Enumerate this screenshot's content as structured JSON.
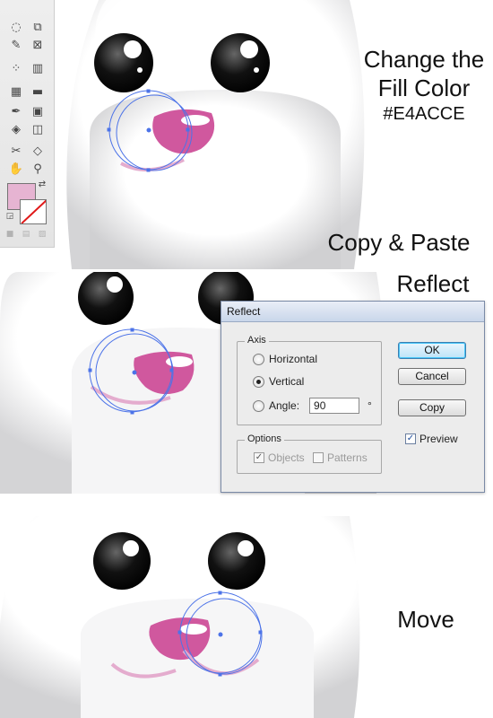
{
  "captions": {
    "step1_line1": "Change the",
    "step1_line2": "Fill Color",
    "step1_hex": "#E4ACCE",
    "step2": "Copy & Paste",
    "step3": "Reflect",
    "step4": "Move"
  },
  "colors": {
    "nose": "#D0589E",
    "fill_swatch": "#E4ACCE",
    "selection": "#4C73E8",
    "mouth_stroke": "#E4ACCE"
  },
  "dialog": {
    "title": "Reflect",
    "axis_group": "Axis",
    "horizontal_label": "Horizontal",
    "vertical_label": "Vertical",
    "angle_label": "Angle:",
    "angle_value": "90",
    "angle_unit": "°",
    "options_group": "Options",
    "objects_label": "Objects",
    "patterns_label": "Patterns",
    "ok_label": "OK",
    "cancel_label": "Cancel",
    "copy_label": "Copy",
    "preview_label": "Preview",
    "selected_axis": "Vertical",
    "preview_checked": true,
    "objects_checked": true,
    "patterns_checked": false
  },
  "toolbox": {
    "tools": [
      "lasso-tool-icon",
      "scale-tool-icon",
      "blob-brush-icon",
      "free-transform-icon",
      "symbol-sprayer-icon",
      "column-graph-icon",
      "mesh-tool-icon",
      "gradient-tool-icon",
      "eyedropper-icon",
      "blend-tool-icon",
      "live-paint-bucket-icon",
      "live-paint-selection-icon",
      "slice-tool-icon",
      "eraser-icon",
      "hand-tool-icon",
      "zoom-tool-icon"
    ]
  }
}
